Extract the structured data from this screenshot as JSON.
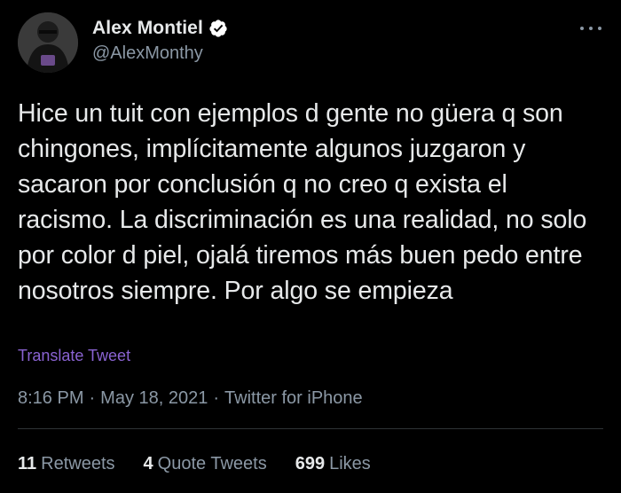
{
  "author": {
    "name": "Alex Montiel",
    "handle": "@AlexMonthy",
    "verified": true
  },
  "tweet": {
    "text": "Hice un tuit con ejemplos d gente no güera q son chingones, implícitamente algunos juzgaron y sacaron por conclusión q no creo q exista el racismo. La discriminación es una realidad, no solo por color d piel, ojalá tiremos más buen pedo entre nosotros siempre. Por algo se empieza",
    "translate_label": "Translate Tweet",
    "time": "8:16 PM",
    "separator": "·",
    "date": "May 18, 2021",
    "source": "Twitter for iPhone"
  },
  "stats": [
    {
      "count": "11",
      "label": "Retweets"
    },
    {
      "count": "4",
      "label": "Quote Tweets"
    },
    {
      "count": "699",
      "label": "Likes"
    }
  ],
  "colors": {
    "background": "#000000",
    "text": "#e7e9ea",
    "secondary": "#8b98a5",
    "link": "#8a63d2",
    "verified": "#ffffff"
  },
  "icons": {
    "verified": "verified-badge-icon",
    "more": "more-options-icon"
  }
}
